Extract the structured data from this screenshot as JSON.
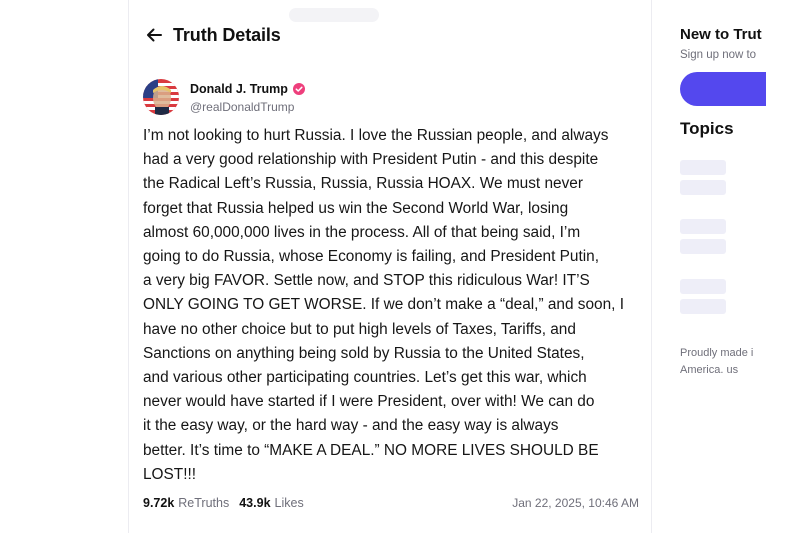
{
  "header": {
    "title": "Truth Details",
    "back_icon": "arrow-left-icon"
  },
  "post": {
    "author": {
      "name": "Donald J. Trump",
      "handle": "@realDonaldTrump",
      "verified_icon": "verified-badge-icon",
      "verified_color": "#ee3f7c"
    },
    "body": "I’m not looking to hurt Russia. I love the Russian people, and always\nhad a very good relationship with President Putin - and this despite\nthe Radical Left’s Russia, Russia, Russia HOAX. We must never\nforget that Russia helped us win the Second World War, losing\nalmost 60,000,000 lives in the process. All of that being said, I’m\ngoing to do Russia, whose Economy is failing, and President Putin,\na very big FAVOR. Settle now, and STOP this ridiculous War! IT’S\nONLY GOING TO GET WORSE. If we don’t make a “deal,” and soon, I\nhave no other choice but to put high levels of Taxes, Tariffs, and\nSanctions on anything being sold by Russia to the United States,\nand various other participating countries. Let’s get this war, which\nnever would have started if I were President, over with! We can do\nit the easy way, or the hard way - and the easy way is always\nbetter. It’s time to “MAKE A DEAL.” NO MORE LIVES SHOULD BE\nLOST!!!",
    "retruths_count": "9.72k",
    "retruths_label": "ReTruths",
    "likes_count": "43.9k",
    "likes_label": "Likes",
    "timestamp": "Jan 22, 2025, 10:46 AM"
  },
  "sidebar": {
    "title": "New to Trut",
    "subtitle": "Sign up now to",
    "signup_button_color": "#5448ee",
    "topics_title": "Topics",
    "footer_line1": "Proudly made i",
    "footer_line2_text": "America. ",
    "footer_line2_link": "us"
  },
  "colors": {
    "accent": "#5448ee",
    "muted_text": "#6f6f7a",
    "skeleton": "#eeeef8"
  }
}
